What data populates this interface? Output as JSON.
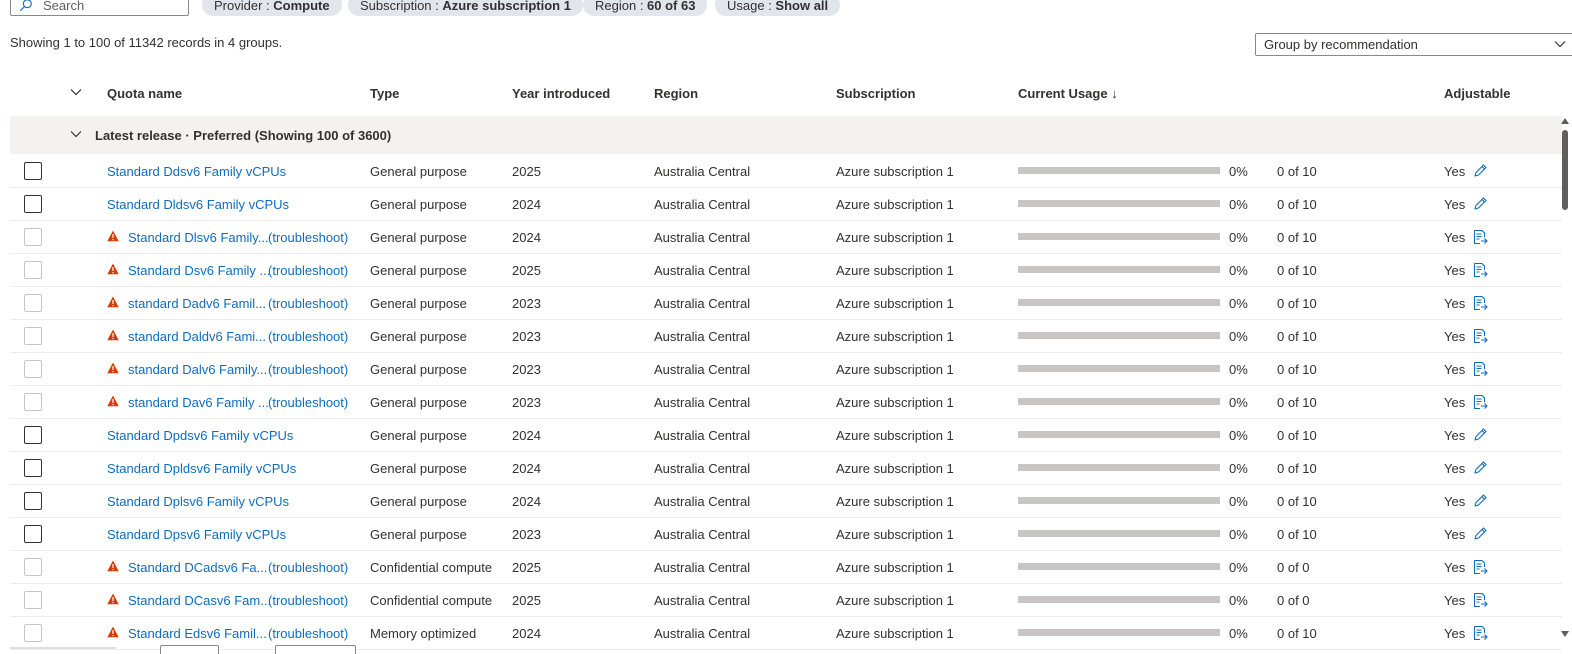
{
  "filters": {
    "search_placeholder": "Search",
    "pills": [
      {
        "key": "Provider",
        "value": "Compute"
      },
      {
        "key": "Subscription",
        "value": "Azure subscription 1"
      },
      {
        "key": "Region",
        "value": "60 of 63"
      },
      {
        "key": "Usage",
        "value": "Show all"
      }
    ]
  },
  "summary": "Showing 1 to 100 of 11342 records in 4 groups.",
  "groupby": {
    "selected": "Group by recommendation"
  },
  "table": {
    "headers": {
      "quota_name": "Quota name",
      "type": "Type",
      "year": "Year introduced",
      "region": "Region",
      "subscription": "Subscription",
      "current_usage": "Current Usage ↓",
      "adjustable": "Adjustable"
    },
    "group_label": "Latest release · Preferred (Showing 100 of 3600)",
    "troubleshoot_label": "troubleshoot",
    "rows": [
      {
        "name": "Standard Ddsv6 Family vCPUs",
        "warning": false,
        "type": "General purpose",
        "year": "2025",
        "region": "Australia Central",
        "subscription": "Azure subscription 1",
        "pct": "0%",
        "usage": "0 of 10",
        "adjustable": "Yes"
      },
      {
        "name": "Standard Dldsv6 Family vCPUs",
        "warning": false,
        "type": "General purpose",
        "year": "2024",
        "region": "Australia Central",
        "subscription": "Azure subscription 1",
        "pct": "0%",
        "usage": "0 of 10",
        "adjustable": "Yes"
      },
      {
        "name": "Standard Dlsv6 Family...",
        "warning": true,
        "type": "General purpose",
        "year": "2024",
        "region": "Australia Central",
        "subscription": "Azure subscription 1",
        "pct": "0%",
        "usage": "0 of 10",
        "adjustable": "Yes"
      },
      {
        "name": "Standard Dsv6 Family ...",
        "warning": true,
        "type": "General purpose",
        "year": "2025",
        "region": "Australia Central",
        "subscription": "Azure subscription 1",
        "pct": "0%",
        "usage": "0 of 10",
        "adjustable": "Yes"
      },
      {
        "name": "standard Dadv6 Famil...",
        "warning": true,
        "type": "General purpose",
        "year": "2023",
        "region": "Australia Central",
        "subscription": "Azure subscription 1",
        "pct": "0%",
        "usage": "0 of 10",
        "adjustable": "Yes"
      },
      {
        "name": "standard Daldv6 Fami...",
        "warning": true,
        "type": "General purpose",
        "year": "2023",
        "region": "Australia Central",
        "subscription": "Azure subscription 1",
        "pct": "0%",
        "usage": "0 of 10",
        "adjustable": "Yes"
      },
      {
        "name": "standard Dalv6 Family...",
        "warning": true,
        "type": "General purpose",
        "year": "2023",
        "region": "Australia Central",
        "subscription": "Azure subscription 1",
        "pct": "0%",
        "usage": "0 of 10",
        "adjustable": "Yes"
      },
      {
        "name": "standard Dav6 Family ...",
        "warning": true,
        "type": "General purpose",
        "year": "2023",
        "region": "Australia Central",
        "subscription": "Azure subscription 1",
        "pct": "0%",
        "usage": "0 of 10",
        "adjustable": "Yes"
      },
      {
        "name": "Standard Dpdsv6 Family vCPUs",
        "warning": false,
        "type": "General purpose",
        "year": "2024",
        "region": "Australia Central",
        "subscription": "Azure subscription 1",
        "pct": "0%",
        "usage": "0 of 10",
        "adjustable": "Yes"
      },
      {
        "name": "Standard Dpldsv6 Family vCPUs",
        "warning": false,
        "type": "General purpose",
        "year": "2024",
        "region": "Australia Central",
        "subscription": "Azure subscription 1",
        "pct": "0%",
        "usage": "0 of 10",
        "adjustable": "Yes"
      },
      {
        "name": "Standard Dplsv6 Family vCPUs",
        "warning": false,
        "type": "General purpose",
        "year": "2024",
        "region": "Australia Central",
        "subscription": "Azure subscription 1",
        "pct": "0%",
        "usage": "0 of 10",
        "adjustable": "Yes"
      },
      {
        "name": "Standard Dpsv6 Family vCPUs",
        "warning": false,
        "type": "General purpose",
        "year": "2023",
        "region": "Australia Central",
        "subscription": "Azure subscription 1",
        "pct": "0%",
        "usage": "0 of 10",
        "adjustable": "Yes"
      },
      {
        "name": "Standard DCadsv6 Fa...",
        "warning": true,
        "type": "Confidential compute",
        "year": "2025",
        "region": "Australia Central",
        "subscription": "Azure subscription 1",
        "pct": "0%",
        "usage": "0 of 0",
        "adjustable": "Yes"
      },
      {
        "name": "Standard DCasv6 Fam...",
        "warning": true,
        "type": "Confidential compute",
        "year": "2025",
        "region": "Australia Central",
        "subscription": "Azure subscription 1",
        "pct": "0%",
        "usage": "0 of 0",
        "adjustable": "Yes"
      },
      {
        "name": "Standard Edsv6 Famil...",
        "warning": true,
        "type": "Memory optimized",
        "year": "2024",
        "region": "Australia Central",
        "subscription": "Azure subscription 1",
        "pct": "0%",
        "usage": "0 of 10",
        "adjustable": "Yes"
      }
    ]
  },
  "colors": {
    "link": "#0f6cbd",
    "warning": "#d83b01",
    "group_bg": "#f3f2f1",
    "bar": "#c8c6c4"
  }
}
